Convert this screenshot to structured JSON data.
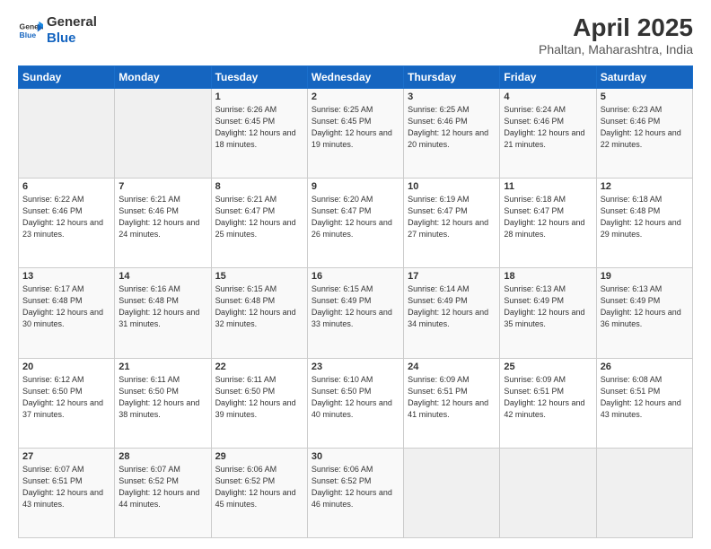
{
  "header": {
    "logo_general": "General",
    "logo_blue": "Blue",
    "title": "April 2025",
    "subtitle": "Phaltan, Maharashtra, India"
  },
  "columns": [
    "Sunday",
    "Monday",
    "Tuesday",
    "Wednesday",
    "Thursday",
    "Friday",
    "Saturday"
  ],
  "weeks": [
    [
      {
        "day": "",
        "info": ""
      },
      {
        "day": "",
        "info": ""
      },
      {
        "day": "1",
        "info": "Sunrise: 6:26 AM\nSunset: 6:45 PM\nDaylight: 12 hours and 18 minutes."
      },
      {
        "day": "2",
        "info": "Sunrise: 6:25 AM\nSunset: 6:45 PM\nDaylight: 12 hours and 19 minutes."
      },
      {
        "day": "3",
        "info": "Sunrise: 6:25 AM\nSunset: 6:46 PM\nDaylight: 12 hours and 20 minutes."
      },
      {
        "day": "4",
        "info": "Sunrise: 6:24 AM\nSunset: 6:46 PM\nDaylight: 12 hours and 21 minutes."
      },
      {
        "day": "5",
        "info": "Sunrise: 6:23 AM\nSunset: 6:46 PM\nDaylight: 12 hours and 22 minutes."
      }
    ],
    [
      {
        "day": "6",
        "info": "Sunrise: 6:22 AM\nSunset: 6:46 PM\nDaylight: 12 hours and 23 minutes."
      },
      {
        "day": "7",
        "info": "Sunrise: 6:21 AM\nSunset: 6:46 PM\nDaylight: 12 hours and 24 minutes."
      },
      {
        "day": "8",
        "info": "Sunrise: 6:21 AM\nSunset: 6:47 PM\nDaylight: 12 hours and 25 minutes."
      },
      {
        "day": "9",
        "info": "Sunrise: 6:20 AM\nSunset: 6:47 PM\nDaylight: 12 hours and 26 minutes."
      },
      {
        "day": "10",
        "info": "Sunrise: 6:19 AM\nSunset: 6:47 PM\nDaylight: 12 hours and 27 minutes."
      },
      {
        "day": "11",
        "info": "Sunrise: 6:18 AM\nSunset: 6:47 PM\nDaylight: 12 hours and 28 minutes."
      },
      {
        "day": "12",
        "info": "Sunrise: 6:18 AM\nSunset: 6:48 PM\nDaylight: 12 hours and 29 minutes."
      }
    ],
    [
      {
        "day": "13",
        "info": "Sunrise: 6:17 AM\nSunset: 6:48 PM\nDaylight: 12 hours and 30 minutes."
      },
      {
        "day": "14",
        "info": "Sunrise: 6:16 AM\nSunset: 6:48 PM\nDaylight: 12 hours and 31 minutes."
      },
      {
        "day": "15",
        "info": "Sunrise: 6:15 AM\nSunset: 6:48 PM\nDaylight: 12 hours and 32 minutes."
      },
      {
        "day": "16",
        "info": "Sunrise: 6:15 AM\nSunset: 6:49 PM\nDaylight: 12 hours and 33 minutes."
      },
      {
        "day": "17",
        "info": "Sunrise: 6:14 AM\nSunset: 6:49 PM\nDaylight: 12 hours and 34 minutes."
      },
      {
        "day": "18",
        "info": "Sunrise: 6:13 AM\nSunset: 6:49 PM\nDaylight: 12 hours and 35 minutes."
      },
      {
        "day": "19",
        "info": "Sunrise: 6:13 AM\nSunset: 6:49 PM\nDaylight: 12 hours and 36 minutes."
      }
    ],
    [
      {
        "day": "20",
        "info": "Sunrise: 6:12 AM\nSunset: 6:50 PM\nDaylight: 12 hours and 37 minutes."
      },
      {
        "day": "21",
        "info": "Sunrise: 6:11 AM\nSunset: 6:50 PM\nDaylight: 12 hours and 38 minutes."
      },
      {
        "day": "22",
        "info": "Sunrise: 6:11 AM\nSunset: 6:50 PM\nDaylight: 12 hours and 39 minutes."
      },
      {
        "day": "23",
        "info": "Sunrise: 6:10 AM\nSunset: 6:50 PM\nDaylight: 12 hours and 40 minutes."
      },
      {
        "day": "24",
        "info": "Sunrise: 6:09 AM\nSunset: 6:51 PM\nDaylight: 12 hours and 41 minutes."
      },
      {
        "day": "25",
        "info": "Sunrise: 6:09 AM\nSunset: 6:51 PM\nDaylight: 12 hours and 42 minutes."
      },
      {
        "day": "26",
        "info": "Sunrise: 6:08 AM\nSunset: 6:51 PM\nDaylight: 12 hours and 43 minutes."
      }
    ],
    [
      {
        "day": "27",
        "info": "Sunrise: 6:07 AM\nSunset: 6:51 PM\nDaylight: 12 hours and 43 minutes."
      },
      {
        "day": "28",
        "info": "Sunrise: 6:07 AM\nSunset: 6:52 PM\nDaylight: 12 hours and 44 minutes."
      },
      {
        "day": "29",
        "info": "Sunrise: 6:06 AM\nSunset: 6:52 PM\nDaylight: 12 hours and 45 minutes."
      },
      {
        "day": "30",
        "info": "Sunrise: 6:06 AM\nSunset: 6:52 PM\nDaylight: 12 hours and 46 minutes."
      },
      {
        "day": "",
        "info": ""
      },
      {
        "day": "",
        "info": ""
      },
      {
        "day": "",
        "info": ""
      }
    ]
  ]
}
